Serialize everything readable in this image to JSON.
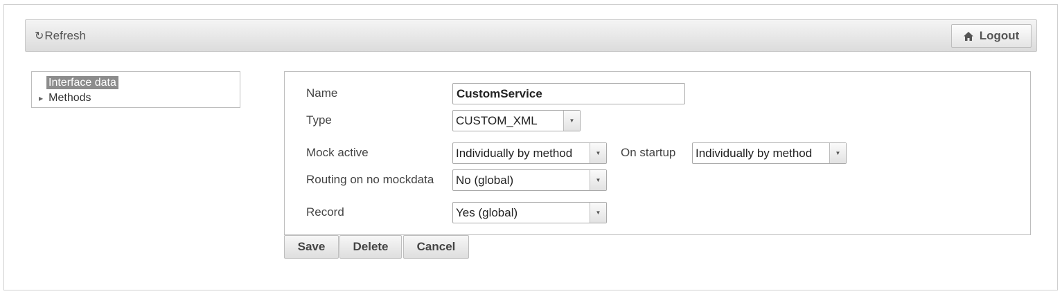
{
  "toolbar": {
    "refresh_icon": "refresh-icon",
    "refresh_label": "Refresh",
    "logout_icon": "home-icon",
    "logout_label": "Logout"
  },
  "tree": {
    "items": [
      {
        "label": "Interface data",
        "selected": true
      },
      {
        "label": "Methods",
        "expandable": true
      }
    ]
  },
  "form": {
    "name": {
      "label": "Name",
      "value": "CustomService"
    },
    "type": {
      "label": "Type",
      "value": "CUSTOM_XML"
    },
    "mock_active": {
      "label": "Mock active",
      "value": "Individually by method"
    },
    "on_startup": {
      "label": "On startup",
      "value": "Individually by method"
    },
    "routing": {
      "label": "Routing on no mockdata",
      "value": "No (global)"
    },
    "record": {
      "label": "Record",
      "value": "Yes (global)"
    }
  },
  "actions": {
    "save": "Save",
    "delete": "Delete",
    "cancel": "Cancel"
  },
  "colors": {
    "selected_tree_bg": "#8c8c8c",
    "border": "#bdbdbd"
  }
}
